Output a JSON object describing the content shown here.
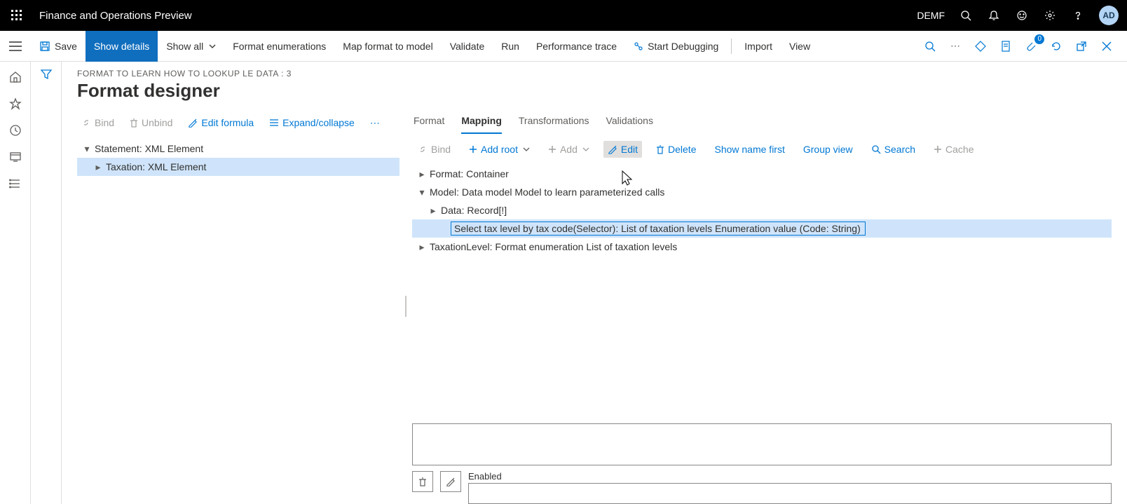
{
  "topbar": {
    "title": "Finance and Operations Preview",
    "entity": "DEMF",
    "avatar": "AD"
  },
  "cmdbar": {
    "save": "Save",
    "show_details": "Show details",
    "show_all": "Show all",
    "format_enum": "Format enumerations",
    "map_format": "Map format to model",
    "validate": "Validate",
    "run": "Run",
    "perf_trace": "Performance trace",
    "start_debug": "Start Debugging",
    "import": "Import",
    "view": "View",
    "badge": "0"
  },
  "page": {
    "breadcrumb": "FORMAT TO LEARN HOW TO LOOKUP LE DATA : 3",
    "title": "Format designer"
  },
  "left_toolbar": {
    "bind": "Bind",
    "unbind": "Unbind",
    "edit_formula": "Edit formula",
    "expand": "Expand/collapse"
  },
  "left_tree": {
    "n0": "Statement: XML Element",
    "n1": "Taxation: XML Element"
  },
  "tabs": {
    "format": "Format",
    "mapping": "Mapping",
    "transformations": "Transformations",
    "validations": "Validations"
  },
  "right_toolbar": {
    "bind": "Bind",
    "add_root": "Add root",
    "add": "Add",
    "edit": "Edit",
    "delete": "Delete",
    "show_name_first": "Show name first",
    "group_view": "Group view",
    "search": "Search",
    "cache": "Cache"
  },
  "right_tree": {
    "n0": "Format: Container",
    "n1": "Model: Data model Model to learn parameterized calls",
    "n2": "Data: Record[!]",
    "n3": "Select tax level by tax code(Selector): List of taxation levels Enumeration value (Code: String)",
    "n4": "TaxationLevel: Format enumeration List of taxation levels"
  },
  "bottom": {
    "enabled_label": "Enabled"
  }
}
